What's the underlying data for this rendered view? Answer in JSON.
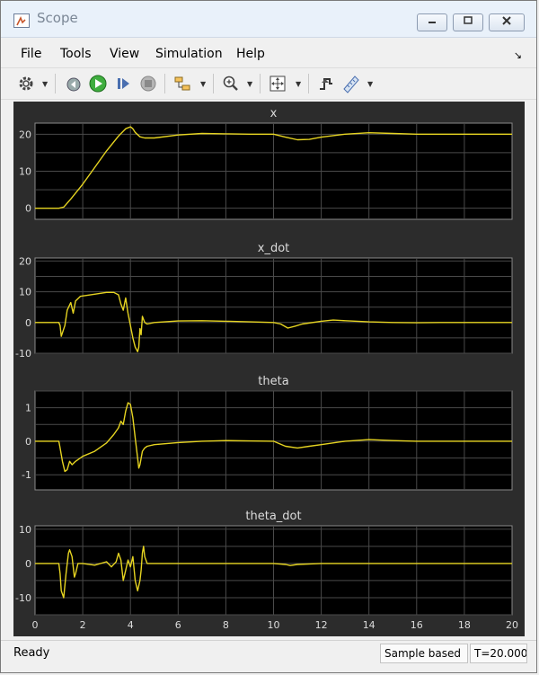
{
  "window": {
    "title": "Scope"
  },
  "menu": {
    "items": [
      "File",
      "Tools",
      "View",
      "Simulation",
      "Help"
    ]
  },
  "status": {
    "text": "Ready",
    "sample_based": "Sample based",
    "time": "T=20.000"
  },
  "colors": {
    "trace": "#e6d421",
    "plot_bg": "#000000",
    "panel_bg": "#2c2c2c",
    "grid": "#4a4a4a",
    "axis_text": "#dcdcdc"
  },
  "chart_data": [
    {
      "type": "line",
      "title": "x",
      "xlim": [
        0,
        20
      ],
      "ylim": [
        -3,
        23
      ],
      "yticks": [
        0,
        10,
        20
      ],
      "xticks": [],
      "x": [
        0,
        1,
        1.2,
        1.5,
        2,
        2.5,
        3,
        3.5,
        3.8,
        4,
        4.1,
        4.2,
        4.4,
        4.6,
        5,
        6,
        7,
        8,
        9,
        10,
        10.5,
        11,
        11.5,
        12,
        13,
        14,
        15,
        16,
        17,
        18,
        19,
        20
      ],
      "y": [
        0,
        0,
        0.3,
        2.5,
        6.5,
        11,
        15.5,
        19.5,
        21.5,
        22,
        21.5,
        20.5,
        19.3,
        19,
        19,
        19.8,
        20.2,
        20.1,
        20,
        20,
        19.2,
        18.5,
        18.6,
        19.2,
        20,
        20.4,
        20.2,
        20,
        20,
        20,
        20,
        20
      ]
    },
    {
      "type": "line",
      "title": "x_dot",
      "xlim": [
        0,
        20
      ],
      "ylim": [
        -10,
        21
      ],
      "yticks": [
        -10,
        0,
        10,
        20
      ],
      "xticks": [],
      "x": [
        0,
        1,
        1.05,
        1.1,
        1.25,
        1.35,
        1.5,
        1.6,
        1.7,
        1.9,
        2.5,
        3,
        3.3,
        3.5,
        3.6,
        3.7,
        3.8,
        3.9,
        4,
        4.1,
        4.2,
        4.3,
        4.35,
        4.4,
        4.45,
        4.5,
        4.6,
        4.7,
        5,
        6,
        7,
        8,
        9,
        10,
        10.3,
        10.6,
        10.9,
        11.2,
        12,
        12.5,
        13,
        14,
        15,
        16,
        17,
        18,
        19,
        20
      ],
      "y": [
        0,
        0,
        -1,
        -4.5,
        -1,
        4,
        6.5,
        3,
        7,
        8.5,
        9.2,
        9.8,
        9.8,
        9,
        6,
        4,
        8,
        3,
        -1,
        -5,
        -8,
        -9.5,
        -8,
        -2,
        -4,
        2,
        0,
        -0.5,
        0,
        0.5,
        0.6,
        0.4,
        0.2,
        0,
        -0.5,
        -1.8,
        -1.2,
        -0.5,
        0.4,
        0.8,
        0.6,
        0.2,
        0,
        -0.1,
        0,
        0,
        0,
        0
      ]
    },
    {
      "type": "line",
      "title": "theta",
      "xlim": [
        0,
        20
      ],
      "ylim": [
        -1.45,
        1.5
      ],
      "yticks": [
        -1,
        0,
        1
      ],
      "xticks": [],
      "x": [
        0,
        1,
        1.05,
        1.15,
        1.25,
        1.35,
        1.45,
        1.55,
        1.7,
        2,
        2.5,
        3,
        3.3,
        3.5,
        3.6,
        3.7,
        3.8,
        3.9,
        4,
        4.1,
        4.2,
        4.3,
        4.35,
        4.4,
        4.5,
        4.6,
        4.7,
        5,
        6,
        7,
        8,
        9,
        10,
        10.5,
        11,
        11.5,
        12,
        13,
        14,
        15,
        16,
        17,
        18,
        19,
        20
      ],
      "y": [
        0,
        0,
        -0.2,
        -0.6,
        -0.9,
        -0.85,
        -0.6,
        -0.7,
        -0.6,
        -0.45,
        -0.3,
        -0.05,
        0.2,
        0.4,
        0.6,
        0.5,
        0.9,
        1.15,
        1.1,
        0.7,
        0.1,
        -0.5,
        -0.8,
        -0.7,
        -0.3,
        -0.2,
        -0.15,
        -0.1,
        -0.04,
        0,
        0.02,
        0.01,
        0,
        -0.15,
        -0.2,
        -0.15,
        -0.1,
        0,
        0.05,
        0.02,
        0,
        0,
        0,
        0,
        0
      ]
    },
    {
      "type": "line",
      "title": "theta_dot",
      "xlim": [
        0,
        20
      ],
      "ylim": [
        -15,
        11
      ],
      "yticks": [
        -10,
        0,
        10
      ],
      "xticks": [
        0,
        2,
        4,
        6,
        8,
        10,
        12,
        14,
        16,
        18,
        20
      ],
      "x": [
        0,
        1,
        1.05,
        1.1,
        1.2,
        1.3,
        1.4,
        1.45,
        1.55,
        1.65,
        1.7,
        1.8,
        2,
        2.5,
        3,
        3.2,
        3.4,
        3.5,
        3.6,
        3.65,
        3.7,
        3.8,
        3.9,
        4,
        4.1,
        4.2,
        4.3,
        4.4,
        4.45,
        4.5,
        4.55,
        4.6,
        4.7,
        5,
        6,
        8,
        10,
        10.5,
        10.7,
        11,
        12,
        14,
        16,
        18,
        20
      ],
      "y": [
        0,
        0,
        -3,
        -8,
        -10,
        -3,
        3,
        4,
        2,
        -4,
        -3,
        0,
        0,
        -0.5,
        0.5,
        -1,
        0.5,
        3,
        1,
        -2,
        -5,
        -2,
        1,
        -1,
        2,
        -5,
        -8,
        -5,
        -2,
        3,
        5,
        2,
        0,
        0,
        0,
        0,
        0,
        -0.3,
        -0.6,
        -0.3,
        0,
        0,
        0,
        0,
        0
      ]
    }
  ]
}
